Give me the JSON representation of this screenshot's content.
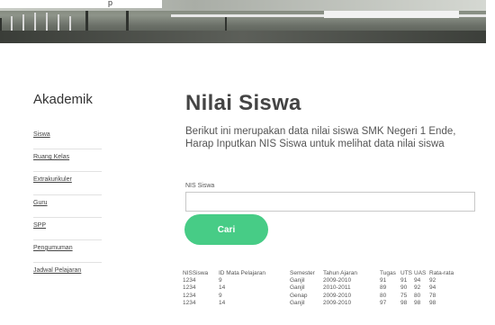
{
  "banner": {
    "partial_text": "p"
  },
  "sidebar": {
    "title": "Akademik",
    "items": [
      {
        "label": "Siswa"
      },
      {
        "label": "Ruang Kelas"
      },
      {
        "label": "Extrakurikuler"
      },
      {
        "label": "Guru"
      },
      {
        "label": "SPP"
      },
      {
        "label": "Pengumuman"
      },
      {
        "label": "Jadwal Pelajaran"
      }
    ]
  },
  "main": {
    "title": "Nilai Siswa",
    "description": "Berikut ini merupakan data nilai siswa SMK Negeri 1 Ende, Harap Inputkan NIS Siswa untuk melihat data nilai siswa",
    "nis_label": "NIS Siswa",
    "nis_value": "",
    "search_button": "Cari"
  },
  "table": {
    "headers": [
      "NISSiswa",
      "ID Mata Pelajaran",
      "Semester",
      "Tahun Ajaran",
      "Tugas",
      "UTS",
      "UAS",
      "Rata-rata"
    ],
    "rows": [
      [
        "1234",
        "9",
        "Ganjil",
        "2009-2010",
        "91",
        "91",
        "94",
        "92"
      ],
      [
        "1234",
        "14",
        "Ganjil",
        "2010-2011",
        "89",
        "90",
        "92",
        "94"
      ],
      [
        "1234",
        "9",
        "Genap",
        "2009-2010",
        "80",
        "75",
        "80",
        "78"
      ],
      [
        "1234",
        "14",
        "Ganjil",
        "2009-2010",
        "97",
        "98",
        "98",
        "98"
      ]
    ]
  },
  "colors": {
    "accent": "#47cc86"
  }
}
